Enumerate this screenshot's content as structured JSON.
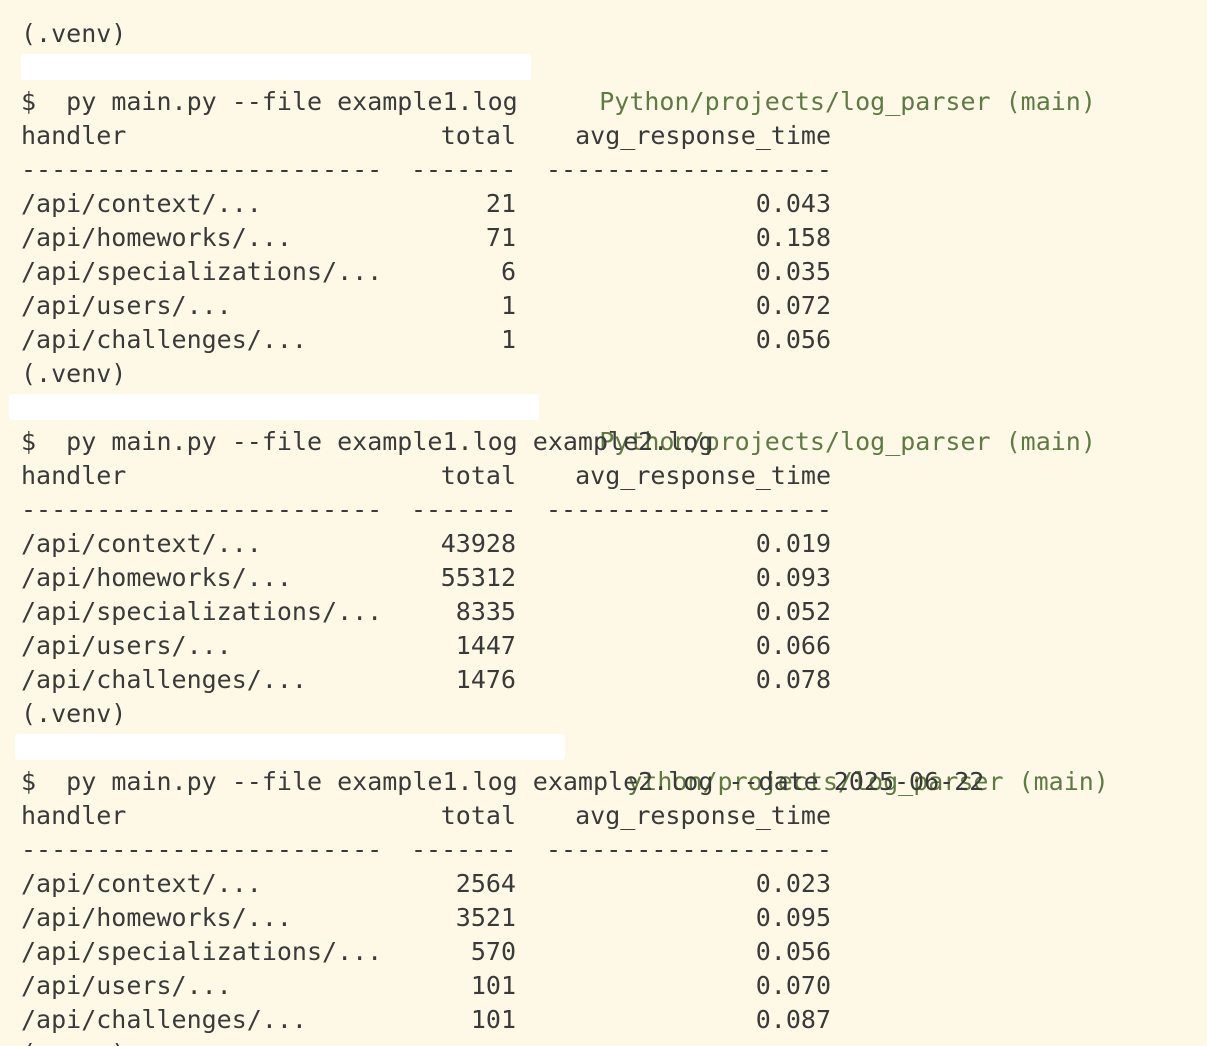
{
  "prompt": "$",
  "venv": "(.venv)",
  "sessions": [
    {
      "path": "Python/projects/log_parser (main)",
      "command": "py main.py --file example1.log",
      "headers": [
        "handler",
        "total",
        "avg_response_time"
      ],
      "separators": [
        "------------------------",
        "-------",
        "-------------------"
      ],
      "rows": [
        {
          "handler": "/api/context/...",
          "total": "21",
          "avg": "0.043"
        },
        {
          "handler": "/api/homeworks/...",
          "total": "71",
          "avg": "0.158"
        },
        {
          "handler": "/api/specializations/...",
          "total": "6",
          "avg": "0.035"
        },
        {
          "handler": "/api/users/...",
          "total": "1",
          "avg": "0.072"
        },
        {
          "handler": "/api/challenges/...",
          "total": "1",
          "avg": "0.056"
        }
      ]
    },
    {
      "path": "Python/projects/log_parser (main)",
      "command": "py main.py --file example1.log example2.log",
      "headers": [
        "handler",
        "total",
        "avg_response_time"
      ],
      "separators": [
        "------------------------",
        "-------",
        "-------------------"
      ],
      "rows": [
        {
          "handler": "/api/context/...",
          "total": "43928",
          "avg": "0.019"
        },
        {
          "handler": "/api/homeworks/...",
          "total": "55312",
          "avg": "0.093"
        },
        {
          "handler": "/api/specializations/...",
          "total": "8335",
          "avg": "0.052"
        },
        {
          "handler": "/api/users/...",
          "total": "1447",
          "avg": "0.066"
        },
        {
          "handler": "/api/challenges/...",
          "total": "1476",
          "avg": "0.078"
        }
      ]
    },
    {
      "path": "ython/projects/log_parser (main)",
      "command": "py main.py --file example1.log example2.log --date 2025-06-22",
      "headers": [
        "handler",
        "total",
        "avg_response_time"
      ],
      "separators": [
        "------------------------",
        "-------",
        "-------------------"
      ],
      "rows": [
        {
          "handler": "/api/context/...",
          "total": "2564",
          "avg": "0.023"
        },
        {
          "handler": "/api/homeworks/...",
          "total": "3521",
          "avg": "0.095"
        },
        {
          "handler": "/api/specializations/...",
          "total": "570",
          "avg": "0.056"
        },
        {
          "handler": "/api/users/...",
          "total": "101",
          "avg": "0.070"
        },
        {
          "handler": "/api/challenges/...",
          "total": "101",
          "avg": "0.087"
        }
      ]
    }
  ],
  "trailing_venv": "(.venv)",
  "colors": {
    "background": "#fef9e7",
    "text": "#3a3a3a",
    "path": "#5f7a45",
    "redaction": "#ffffff"
  }
}
